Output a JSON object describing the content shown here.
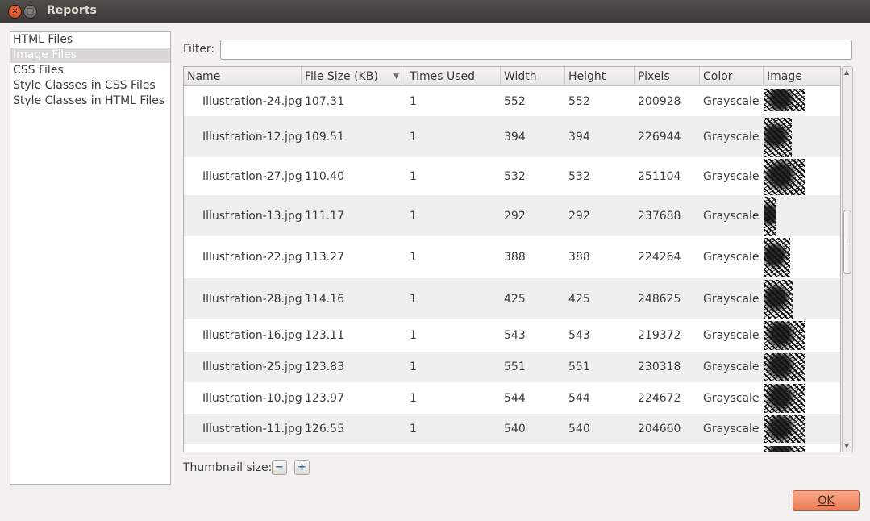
{
  "window": {
    "title": "Reports"
  },
  "sidebar": {
    "items": [
      {
        "label": "HTML Files",
        "selected": false
      },
      {
        "label": "Image Files",
        "selected": true
      },
      {
        "label": "CSS Files",
        "selected": false
      },
      {
        "label": "Style Classes in CSS Files",
        "selected": false
      },
      {
        "label": "Style Classes in HTML Files",
        "selected": false
      }
    ]
  },
  "filter": {
    "label": "Filter:",
    "value": ""
  },
  "table": {
    "columns": [
      "Name",
      "File Size (KB)",
      "Times Used",
      "Width",
      "Height",
      "Pixels",
      "Color",
      "Image"
    ],
    "sorted_column": "File Size (KB)",
    "rows": [
      {
        "name": "Illustration-24.jpg",
        "size": "107.31",
        "used": "1",
        "width": "552",
        "height": "552",
        "pixels": "200928",
        "color": "Grayscale"
      },
      {
        "name": "Illustration-12.jpg",
        "size": "109.51",
        "used": "1",
        "width": "394",
        "height": "394",
        "pixels": "226944",
        "color": "Grayscale"
      },
      {
        "name": "Illustration-27.jpg",
        "size": "110.40",
        "used": "1",
        "width": "532",
        "height": "532",
        "pixels": "251104",
        "color": "Grayscale"
      },
      {
        "name": "Illustration-13.jpg",
        "size": "111.17",
        "used": "1",
        "width": "292",
        "height": "292",
        "pixels": "237688",
        "color": "Grayscale"
      },
      {
        "name": "Illustration-22.jpg",
        "size": "113.27",
        "used": "1",
        "width": "388",
        "height": "388",
        "pixels": "224264",
        "color": "Grayscale"
      },
      {
        "name": "Illustration-28.jpg",
        "size": "114.16",
        "used": "1",
        "width": "425",
        "height": "425",
        "pixels": "248625",
        "color": "Grayscale"
      },
      {
        "name": "Illustration-16.jpg",
        "size": "123.11",
        "used": "1",
        "width": "543",
        "height": "543",
        "pixels": "219372",
        "color": "Grayscale"
      },
      {
        "name": "Illustration-25.jpg",
        "size": "123.83",
        "used": "1",
        "width": "551",
        "height": "551",
        "pixels": "230318",
        "color": "Grayscale"
      },
      {
        "name": "Illustration-10.jpg",
        "size": "123.97",
        "used": "1",
        "width": "544",
        "height": "544",
        "pixels": "224672",
        "color": "Grayscale"
      },
      {
        "name": "Illustration-11.jpg",
        "size": "126.55",
        "used": "1",
        "width": "540",
        "height": "540",
        "pixels": "204660",
        "color": "Grayscale"
      },
      {
        "name": "",
        "size": "",
        "used": "",
        "width": "",
        "height": "",
        "pixels": "",
        "color": ""
      }
    ]
  },
  "thumbnail": {
    "label": "Thumbnail size:",
    "decrease_icon": "minus-icon",
    "increase_icon": "plus-icon"
  },
  "footer": {
    "ok_label": "OK"
  },
  "colors": {
    "ok_button": "#ec7c54",
    "titlebar": "#3c3b37",
    "close_button": "#e9541f"
  }
}
